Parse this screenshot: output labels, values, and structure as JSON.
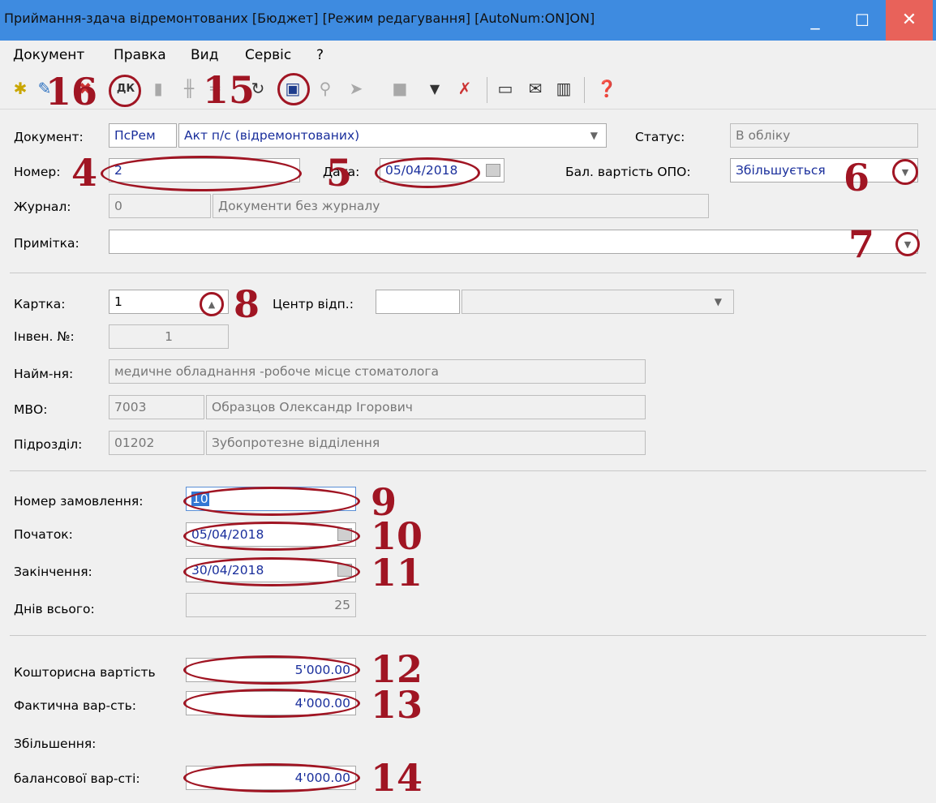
{
  "window": {
    "title": "Приймання-здача відремонтованих [Бюджет] [Режим редагування] [AutoNum:ON]ON]",
    "minimize": "_",
    "maximize": "☐",
    "close": "✕"
  },
  "menu": [
    "Документ",
    "Правка",
    "Вид",
    "Сервіс",
    "?"
  ],
  "toolbar_icons": [
    "new-doc-icon",
    "add-icon",
    "delete-icon",
    "dk-icon",
    "copy-icon",
    "split-icon",
    "merge-icon",
    "refresh-icon",
    "save-icon",
    "key-icon",
    "forward-icon",
    "table-icon",
    "filter-icon",
    "clear-filter-icon",
    "form-icon",
    "mail-icon",
    "barcode-icon",
    "help-icon"
  ],
  "form": {
    "document": {
      "label": "Документ:",
      "code": "ПсРем",
      "name": "Акт п/с (відремонтованих)"
    },
    "status": {
      "label": "Статус:",
      "value": "В обліку"
    },
    "number": {
      "label": "Номер:",
      "value": "2"
    },
    "date": {
      "label": "Дата:",
      "value": "05/04/2018"
    },
    "bal_value": {
      "label": "Бал. вартість ОПО:",
      "value": "Збільшується"
    },
    "journal": {
      "label": "Журнал:",
      "code": "0",
      "name": "Документи без журналу"
    },
    "note": {
      "label": "Примітка:",
      "value": ""
    },
    "card": {
      "label": "Картка:",
      "value": "1"
    },
    "center": {
      "label": "Центр відп.:",
      "code": "",
      "name": ""
    },
    "inv_no": {
      "label": "Інвен. №:",
      "value": "1"
    },
    "name": {
      "label": "Найм-ня:",
      "value": "медичне обладнання -робоче місце стоматолога"
    },
    "mvo": {
      "label": "МВО:",
      "code": "7003",
      "name": "Образцов Олександр Ігорович"
    },
    "division": {
      "label": "Підрозділ:",
      "code": "01202",
      "name": "Зубопротезне відділення"
    },
    "order_no": {
      "label": "Номер замовлення:",
      "value": "10"
    },
    "start": {
      "label": "Початок:",
      "value": "05/04/2018"
    },
    "end": {
      "label": "Закінчення:",
      "value": "30/04/2018"
    },
    "days": {
      "label": "Днів всього:",
      "value": "25"
    },
    "est_cost": {
      "label": "Кошторисна вартість",
      "value": "5'000.00"
    },
    "actual_cost": {
      "label": "Фактична вар-сть:",
      "value": "4'000.00"
    },
    "increase": {
      "label1": "Збільшення:",
      "label2": "балансової вар-сті:",
      "value": "4'000.00"
    }
  },
  "annotations": [
    "16",
    "15",
    "4",
    "5",
    "6",
    "7",
    "8",
    "9",
    "10",
    "11",
    "12",
    "13",
    "14"
  ]
}
